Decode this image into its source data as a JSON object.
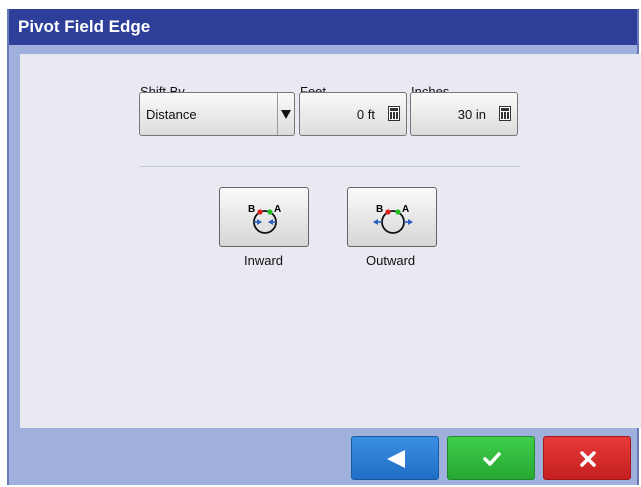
{
  "window": {
    "title": "Pivot Field Edge"
  },
  "form": {
    "shift_by": {
      "label": "Shift By",
      "value": "Distance"
    },
    "feet": {
      "label": "Feet",
      "value": "0 ft"
    },
    "inches": {
      "label": "Inches",
      "value": "30 in"
    }
  },
  "direction": {
    "inward": {
      "label": "Inward",
      "icon": "inward-shift-icon",
      "point_b": "B",
      "point_a": "A"
    },
    "outward": {
      "label": "Outward",
      "icon": "outward-shift-icon",
      "point_b": "B",
      "point_a": "A"
    }
  },
  "footer": {
    "back_icon": "left-arrow-icon",
    "ok_icon": "checkmark-icon",
    "cancel_icon": "x-icon"
  },
  "colors": {
    "title_bar": "#2e3f9a",
    "panel": "#e8e9f1",
    "footer": "#9fb0dd",
    "back": "#2a7fd4",
    "ok": "#31bd3e",
    "cancel": "#d62a2a",
    "point_b": "#e02020",
    "point_a": "#20c020",
    "arrow": "#2a5fc0"
  }
}
